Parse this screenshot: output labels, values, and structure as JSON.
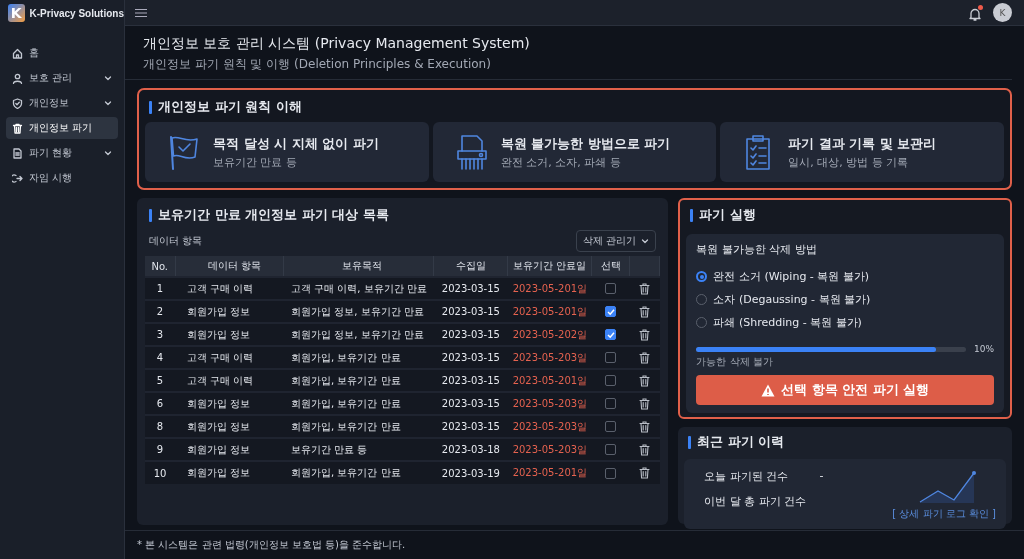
{
  "app": {
    "logo_letter": "K",
    "name": "K-Privacy Solutions"
  },
  "topbar": {
    "unread": true,
    "avatar": "K"
  },
  "sidebar": {
    "items": [
      {
        "label": "홈",
        "selected": false
      },
      {
        "label": "보호 관리",
        "selected": false,
        "expanded": false
      },
      {
        "label": "개인정보",
        "selected": false,
        "expanded": false
      },
      {
        "label": "개인정보 파기",
        "selected": true
      },
      {
        "label": "파기 현황",
        "selected": false,
        "expanded": false
      },
      {
        "label": "자임 시행",
        "selected": false
      }
    ]
  },
  "header": {
    "title": "개인정보 보호 관리 시스템 (Privacy Management System)",
    "subtitle": "개인정보 파기 원칙 및 이행 (Deletion Principles & Execution)"
  },
  "principles": {
    "title": "개인정보 파기 원칙 이해",
    "highlighted": true,
    "cards": [
      {
        "title": "목적 달성 시 지체 없이 파기",
        "desc": "보유기간 만료 등"
      },
      {
        "title": "복원 불가능한 방법으로 파기",
        "desc": "완전 소거, 소자, 파쇄 등"
      },
      {
        "title": "파기 결과 기록 및 보관리",
        "desc": "일시, 대상, 방법 등 기록"
      }
    ]
  },
  "targets": {
    "title": "보유기간 만료 개인정보 파기 대상 목록",
    "filter_label": "데이터 항목",
    "dropdown": "삭제 관리기",
    "columns": [
      "No.",
      "데이터 항목",
      "보유목적",
      "수집일",
      "보유기간 안료일",
      "선택"
    ],
    "rows": [
      {
        "cells": [
          "1",
          "고객 구매 이력",
          "고객 구매 이력, 보유기간 만료",
          "2023-03-15",
          "2023-05-201일"
        ],
        "checked": false
      },
      {
        "cells": [
          "2",
          "회원가입 정보",
          "회원가입 정보, 보유기간 만료",
          "2023-03-15",
          "2023-05-201일"
        ],
        "checked": true
      },
      {
        "cells": [
          "3",
          "회원가입 정보",
          "회원가입 정보, 보유기간 만료",
          "2023-03-15",
          "2023-05-202일"
        ],
        "checked": true
      },
      {
        "cells": [
          "4",
          "고객 구매 이력",
          "회원가입, 보유기간 만료",
          "2023-03-15",
          "2023-05-203일"
        ],
        "checked": false
      },
      {
        "cells": [
          "5",
          "고객 구매 이력",
          "회원가입, 보유기간 만료",
          "2023-03-15",
          "2023-05-201일"
        ],
        "checked": false
      },
      {
        "cells": [
          "6",
          "회원가입 정보",
          "회원가입, 보유기간 만료",
          "2023-03-15",
          "2023-05-203일"
        ],
        "checked": false
      },
      {
        "cells": [
          "8",
          "회원가입 정보",
          "회원가입, 보유기간 만료",
          "2023-03-15",
          "2023-05-203일"
        ],
        "checked": false
      },
      {
        "cells": [
          "9",
          "회원가입 정보",
          "보유기간 만료 등",
          "2023-03-18",
          "2023-05-203일"
        ],
        "checked": false
      },
      {
        "cells": [
          "10",
          "회원가입 정보",
          "회원가입, 보유기간 만료",
          "2023-03-19",
          "2023-05-201일"
        ],
        "checked": false
      }
    ]
  },
  "execution": {
    "title": "파기 실행",
    "highlighted": true,
    "method_title": "복원 불가능한 삭제 방법",
    "options": [
      {
        "label": "완전 소거 (Wiping - 복원 불가)",
        "selected": true
      },
      {
        "label": "소자 (Degaussing - 복원 불가)",
        "selected": false
      },
      {
        "label": "파쇄 (Shredding - 복원 불가)",
        "selected": false
      }
    ],
    "progress": {
      "level": 0.89,
      "reading": "10%",
      "caption": "가능한 삭제 불가"
    },
    "button": "선택 항목 안전 파기 실행"
  },
  "history": {
    "title": "최근 파기 이력",
    "stats": [
      {
        "label": "오늘 파기된 건수",
        "value": "-"
      },
      {
        "label": "이번 달 총 파기 건수"
      }
    ],
    "link": "[ 상세 파기 로그 확인 ]"
  },
  "footer": "* 본 시스템은 관련 법령(개인정보 보호법 등)을 준수합니다."
}
